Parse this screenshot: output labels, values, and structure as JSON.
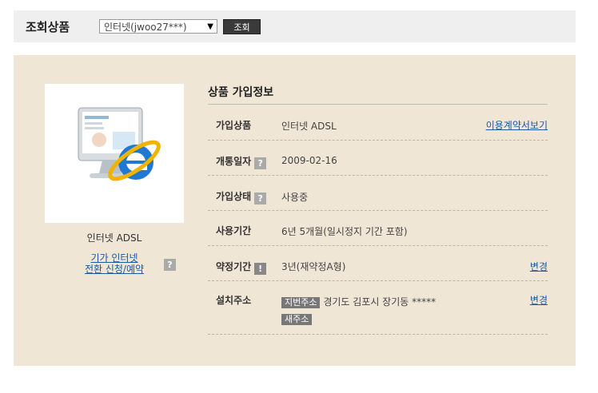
{
  "top": {
    "title": "조회상품",
    "select_value": "인터넷(jwoo27***)",
    "button": "조회"
  },
  "product": {
    "name": "인터넷 ADSL",
    "link_line1": "기가 인터넷",
    "link_line2": "전환 신청/예약",
    "help": "?"
  },
  "info": {
    "section_title": "상품 가입정보",
    "rows": [
      {
        "label": "가입상품",
        "value": "인터넷 ADSL",
        "link": "이용계약서보기"
      },
      {
        "label": "개통일자",
        "value": "2009-02-16"
      },
      {
        "label": "가입상태",
        "value": "사용중"
      },
      {
        "label": "사용기간",
        "value": "6년 5개월(일시정지 기간 포함)"
      },
      {
        "label": "약정기간",
        "value": "3년(재약정A형)",
        "link": "변경"
      },
      {
        "label": "설치주소",
        "tag_old": "지번주소",
        "value": "경기도 김포시 장기동 *****",
        "tag_new": "새주소",
        "link": "변경"
      }
    ]
  },
  "icons": {
    "help": "?",
    "warn": "!"
  }
}
